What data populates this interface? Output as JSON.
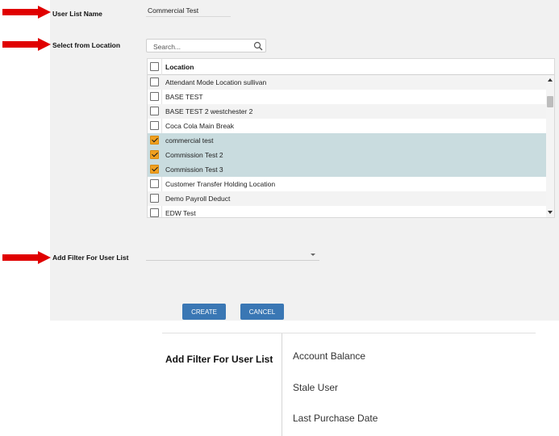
{
  "colors": {
    "arrow": "#e00000",
    "panel_bg": "#f1f1f1",
    "checkbox_checked": "#f0a020",
    "selected_row_bg": "#c9dcdf",
    "button_bg": "#3a77b4"
  },
  "form": {
    "user_list_name_label": "User List Name",
    "user_list_name_value": "Commercial Test",
    "select_location_label": "Select from Location",
    "search_placeholder": "Search...",
    "add_filter_label": "Add Filter For User List",
    "add_filter_value": ""
  },
  "table": {
    "header": "Location",
    "rows": [
      {
        "label": "Attendant Mode Location sullivan",
        "checked": false
      },
      {
        "label": "BASE TEST",
        "checked": false
      },
      {
        "label": "BASE TEST 2 westchester 2",
        "checked": false
      },
      {
        "label": "Coca Cola Main Break",
        "checked": false
      },
      {
        "label": "commercial test",
        "checked": true
      },
      {
        "label": "Commission Test 2",
        "checked": true
      },
      {
        "label": "Commission Test 3",
        "checked": true
      },
      {
        "label": "Customer Transfer Holding Location",
        "checked": false
      },
      {
        "label": "Demo Payroll Deduct",
        "checked": false
      },
      {
        "label": "EDW Test",
        "checked": false
      }
    ]
  },
  "buttons": {
    "create": "CREATE",
    "cancel": "CANCEL"
  },
  "filter_dropdown": {
    "title": "Add Filter For User List",
    "options": [
      "Account Balance",
      "Stale User",
      "Last Purchase Date"
    ]
  }
}
